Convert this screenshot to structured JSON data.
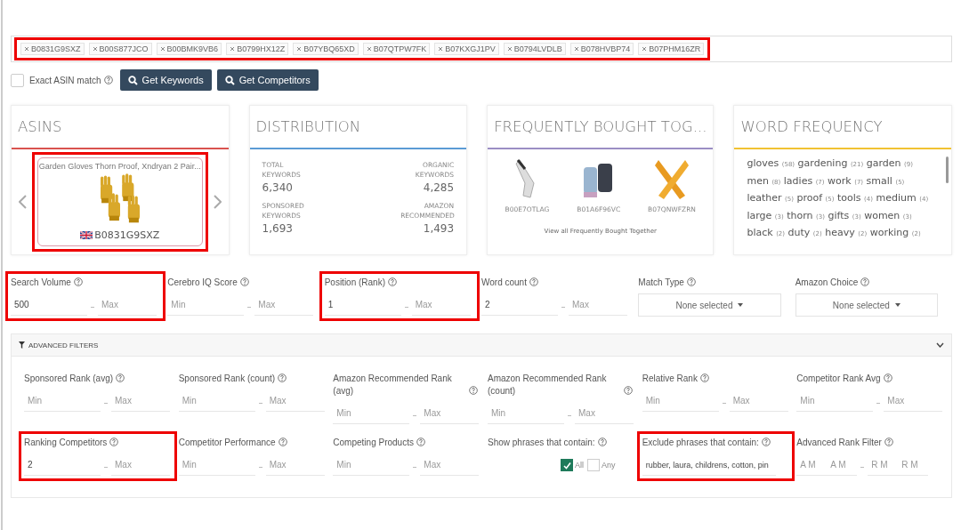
{
  "asin_tags": {
    "highlighted": true,
    "tags": [
      "B0831G9SXZ",
      "B00S877JCO",
      "B00BMK9VB6",
      "B0799HX12Z",
      "B07YBQ65XD",
      "B07QTPW7FK",
      "B07KXGJ1PV",
      "B0794LVDLB",
      "B078HVBP74",
      "B07PHM16ZR"
    ]
  },
  "exact_match": {
    "label": "Exact ASIN match",
    "checked": false
  },
  "buttons": [
    "Get Keywords",
    "Get Competitors"
  ],
  "cards": [
    {
      "kind": "asins",
      "title": "ASINS",
      "color": "#d9534f",
      "product": {
        "title": "Garden Gloves Thorn Proof, Xndryan 2 Pair...",
        "asin": "B0831G9SXZ",
        "highlighted": true
      }
    },
    {
      "kind": "distribution",
      "title": "DISTRIBUTION",
      "color": "#5b9bd5",
      "stats": [
        {
          "label": "TOTAL KEYWORDS",
          "value": "6,340"
        },
        {
          "label": "ORGANIC KEYWORDS",
          "value": "4,285"
        },
        {
          "label": "SPONSORED KEYWORDS",
          "value": "1,693"
        },
        {
          "label": "AMAZON RECOMMENDED",
          "value": "1,493"
        }
      ]
    },
    {
      "kind": "fbt",
      "title": "FREQUENTLY BOUGHT TOG...",
      "color": "#9b8ec4",
      "products": [
        {
          "asin": "B00E7OTLAG"
        },
        {
          "asin": "B01A6F96VC"
        },
        {
          "asin": "B07QNWFZRN"
        }
      ],
      "link": "View all Frequently Bought Together"
    },
    {
      "kind": "words",
      "title": "WORD FREQUENCY",
      "color": "#f1c232",
      "words": [
        {
          "word": "gloves",
          "count": "(58)"
        },
        {
          "word": "gardening",
          "count": "(21)"
        },
        {
          "word": "garden",
          "count": "(9)"
        },
        {
          "word": "men",
          "count": "(8)"
        },
        {
          "word": "ladies",
          "count": "(7)"
        },
        {
          "word": "work",
          "count": "(7)"
        },
        {
          "word": "small",
          "count": "(5)"
        },
        {
          "word": "leather",
          "count": "(5)"
        },
        {
          "word": "proof",
          "count": "(5)"
        },
        {
          "word": "tools",
          "count": "(4)"
        },
        {
          "word": "medium",
          "count": "(4)"
        },
        {
          "word": "large",
          "count": "(3)"
        },
        {
          "word": "thorn",
          "count": "(3)"
        },
        {
          "word": "gifts",
          "count": "(3)"
        },
        {
          "word": "women",
          "count": "(3)"
        },
        {
          "word": "black",
          "count": "(2)"
        },
        {
          "word": "duty",
          "count": "(2)"
        },
        {
          "word": "heavy",
          "count": "(2)"
        },
        {
          "word": "working",
          "count": "(2)"
        }
      ]
    }
  ],
  "filters": [
    {
      "label": "Search Volume",
      "kind": "range",
      "highlighted": true,
      "inputs": [
        {
          "text": "500",
          "filled": true
        },
        {
          "text": "Max",
          "filled": false
        }
      ]
    },
    {
      "label": "Cerebro IQ Score",
      "kind": "range",
      "highlighted": false,
      "inputs": [
        {
          "text": "Min",
          "filled": false
        },
        {
          "text": "Max",
          "filled": false
        }
      ]
    },
    {
      "label": "Position (Rank)",
      "kind": "range",
      "highlighted": true,
      "inputs": [
        {
          "text": "1",
          "filled": true
        },
        {
          "text": "Max",
          "filled": false
        }
      ]
    },
    {
      "label": "Word count",
      "kind": "range",
      "highlighted": false,
      "inputs": [
        {
          "text": "2",
          "filled": true
        },
        {
          "text": "Max",
          "filled": false
        }
      ]
    },
    {
      "label": "Match Type",
      "kind": "select",
      "highlighted": false,
      "value": "None selected"
    },
    {
      "label": "Amazon Choice",
      "kind": "select",
      "highlighted": false,
      "value": "None selected"
    }
  ],
  "advanced": {
    "title": "ADVANCED FILTERS",
    "expanded": true,
    "filters": [
      {
        "label": "Sponsored Rank (avg)",
        "kind": "range",
        "highlighted": false,
        "inputs": [
          {
            "text": "Min",
            "filled": false
          },
          {
            "text": "Max",
            "filled": false
          }
        ]
      },
      {
        "label": "Sponsored Rank (count)",
        "kind": "range",
        "highlighted": false,
        "inputs": [
          {
            "text": "Min",
            "filled": false
          },
          {
            "text": "Max",
            "filled": false
          }
        ]
      },
      {
        "label": "Amazon Recommended Rank (avg)",
        "kind": "range",
        "highlighted": false,
        "inputs": [
          {
            "text": "Min",
            "filled": false
          },
          {
            "text": "Max",
            "filled": false
          }
        ]
      },
      {
        "label": "Amazon Recommended Rank (count)",
        "kind": "range",
        "highlighted": false,
        "inputs": [
          {
            "text": "Min",
            "filled": false
          },
          {
            "text": "Max",
            "filled": false
          }
        ]
      },
      {
        "label": "Relative Rank",
        "kind": "range",
        "highlighted": false,
        "inputs": [
          {
            "text": "Min",
            "filled": false
          },
          {
            "text": "Max",
            "filled": false
          }
        ]
      },
      {
        "label": "Competitor Rank Avg",
        "kind": "range",
        "highlighted": false,
        "inputs": [
          {
            "text": "Min",
            "filled": false
          },
          {
            "text": "Max",
            "filled": false
          }
        ]
      },
      {
        "label": "Ranking Competitors",
        "kind": "range",
        "highlighted": true,
        "inputs": [
          {
            "text": "2",
            "filled": true
          },
          {
            "text": "Max",
            "filled": false
          }
        ]
      },
      {
        "label": "Competitor Performance",
        "kind": "range",
        "highlighted": false,
        "inputs": [
          {
            "text": "Min",
            "filled": false
          },
          {
            "text": "Max",
            "filled": false
          }
        ]
      },
      {
        "label": "Competing Products",
        "kind": "range",
        "highlighted": false,
        "inputs": [
          {
            "text": "Min",
            "filled": false
          },
          {
            "text": "Max",
            "filled": false
          }
        ]
      },
      {
        "label": "Show phrases that contain:",
        "kind": "checks",
        "highlighted": false,
        "options": [
          {
            "label": "All",
            "checked": true
          },
          {
            "label": "Any",
            "checked": false
          }
        ]
      },
      {
        "label": "Exclude phrases that contain:",
        "kind": "text",
        "highlighted": true,
        "value": "rubber, laura, childrens, cotton, pin"
      },
      {
        "label": "Advanced Rank Filter",
        "kind": "quad",
        "highlighted": false,
        "inputs": [
          {
            "text": "A M",
            "filled": false
          },
          {
            "text": "A M",
            "filled": false
          },
          {
            "text": "R M",
            "filled": false
          },
          {
            "text": "R M",
            "filled": false
          }
        ]
      }
    ]
  }
}
